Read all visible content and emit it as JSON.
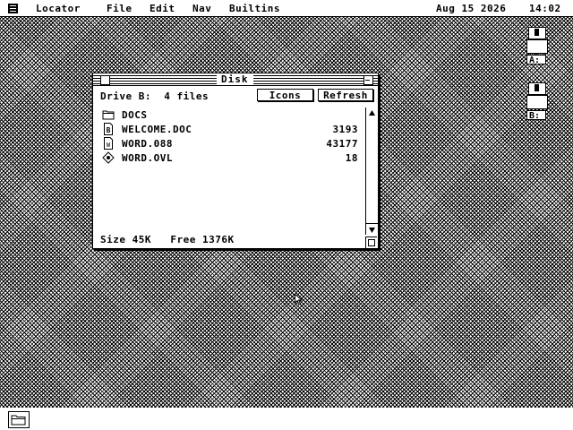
{
  "menubar": {
    "icon": "desk-accessory-icon",
    "items": [
      "Locator",
      "File",
      "Edit",
      "Nav",
      "Builtins"
    ],
    "date": "Aug 15 2026",
    "time": "14:02"
  },
  "drives": [
    {
      "label": "A:",
      "icon": "floppy-drive-icon"
    },
    {
      "label": "B:",
      "icon": "floppy-drive-icon"
    }
  ],
  "window": {
    "title": "Disk",
    "drive_label": "Drive B:",
    "file_count": "4 files",
    "buttons": {
      "icons": "Icons",
      "refresh": "Refresh"
    },
    "files": [
      {
        "name": "DOCS",
        "size": "",
        "icon": "folder-icon"
      },
      {
        "name": "WELCOME.DOC",
        "size": "3193",
        "icon": "document-b-icon"
      },
      {
        "name": "WORD.088",
        "size": "43177",
        "icon": "document-w-icon"
      },
      {
        "name": "WORD.OVL",
        "size": "18",
        "icon": "overlay-diamond-icon"
      }
    ],
    "status": {
      "size_label": "Size",
      "size_value": "45K",
      "free_label": "Free",
      "free_value": "1376K"
    }
  },
  "taskbar": {
    "icon": "folder-icon"
  }
}
